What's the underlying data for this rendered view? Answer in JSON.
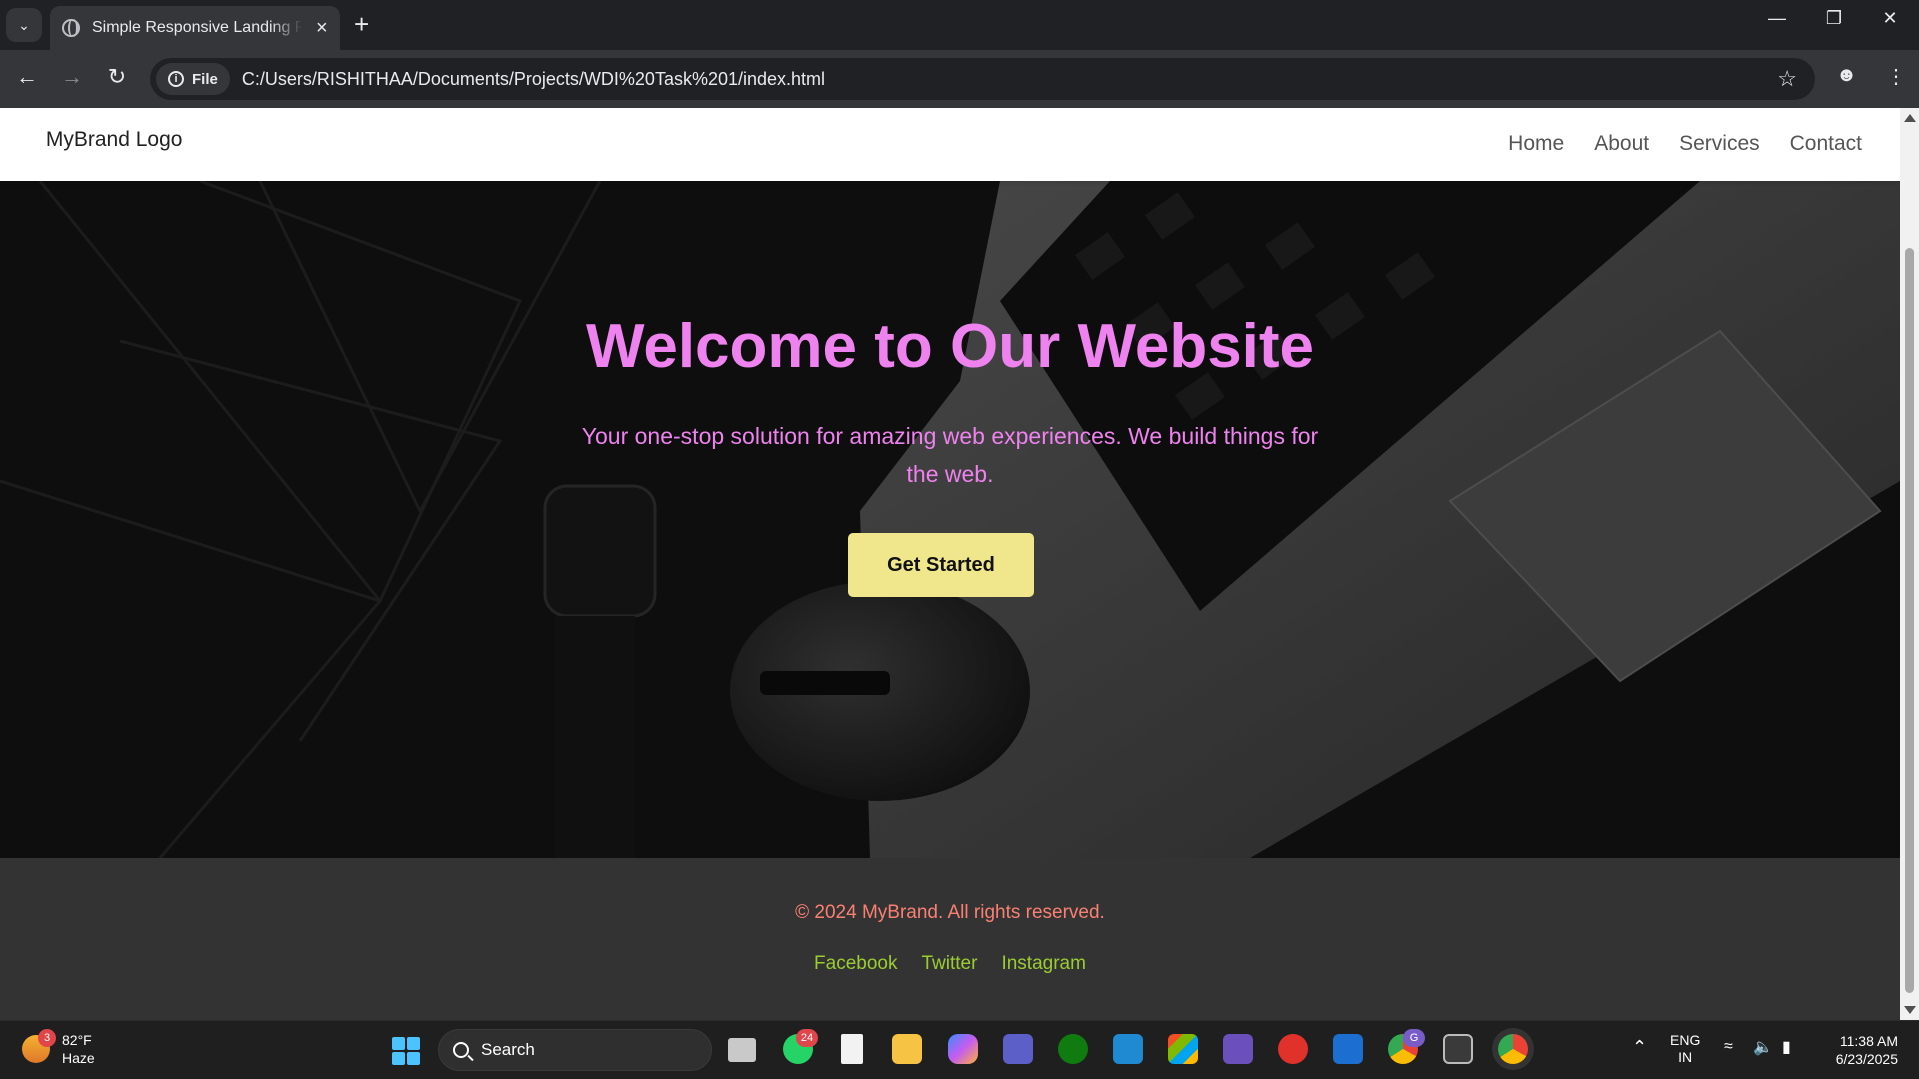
{
  "browser": {
    "tab_title": "Simple Responsive Landing Page",
    "url_scheme_label": "File",
    "url": "C:/Users/RISHITHAA/Documents/Projects/WDI%20Task%201/index.html"
  },
  "header": {
    "logo_alt": "MyBrand Logo",
    "nav": [
      "Home",
      "About",
      "Services",
      "Contact"
    ]
  },
  "hero": {
    "title": "Welcome to Our Website",
    "subtitle": "Your one-stop solution for amazing web experiences. We build things for the web.",
    "cta": "Get Started"
  },
  "footer": {
    "copyright": "© 2024 MyBrand. All rights reserved.",
    "links": [
      "Facebook",
      "Twitter",
      "Instagram"
    ]
  },
  "taskbar": {
    "weather_badge": "3",
    "temperature": "82°F",
    "condition": "Haze",
    "search_placeholder": "Search",
    "whatsapp_badge": "24",
    "chrome_badge": "G",
    "lang": "ENG",
    "region": "IN",
    "time": "11:38 AM",
    "date": "6/23/2025"
  },
  "colors": {
    "hero_text": "#ee82ee",
    "cta_bg": "#f0e68c",
    "footer_bg": "#333333",
    "copyright": "#fa8072",
    "social_link": "#9acd32"
  }
}
